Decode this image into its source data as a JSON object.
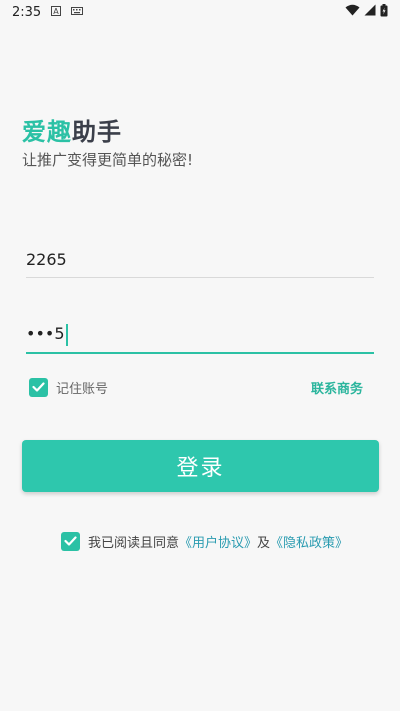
{
  "status_bar": {
    "time": "2:35",
    "icons": [
      "a-badge-icon",
      "keyboard-icon",
      "wifi-icon",
      "signal-icon",
      "battery-icon"
    ]
  },
  "brand": {
    "accent_text": "爱趣",
    "rest_text": "助手",
    "accent_color": "#2bc1a5"
  },
  "slogan": "让推广变得更简单的秘密!",
  "login_form": {
    "username_value": "2265",
    "password_value": "•••5",
    "remember_label": "记住账号",
    "remember_checked": true,
    "contact_label": "联系商务",
    "login_label": "登录"
  },
  "agreement": {
    "checked": true,
    "prefix": "我已阅读且同意",
    "user_agreement": "《用户协议》",
    "and": "及",
    "privacy_policy": "《隐私政策》"
  },
  "colors": {
    "primary": "#2ec7ad",
    "link": "#2a9bb0",
    "background": "#f7f7f7"
  }
}
